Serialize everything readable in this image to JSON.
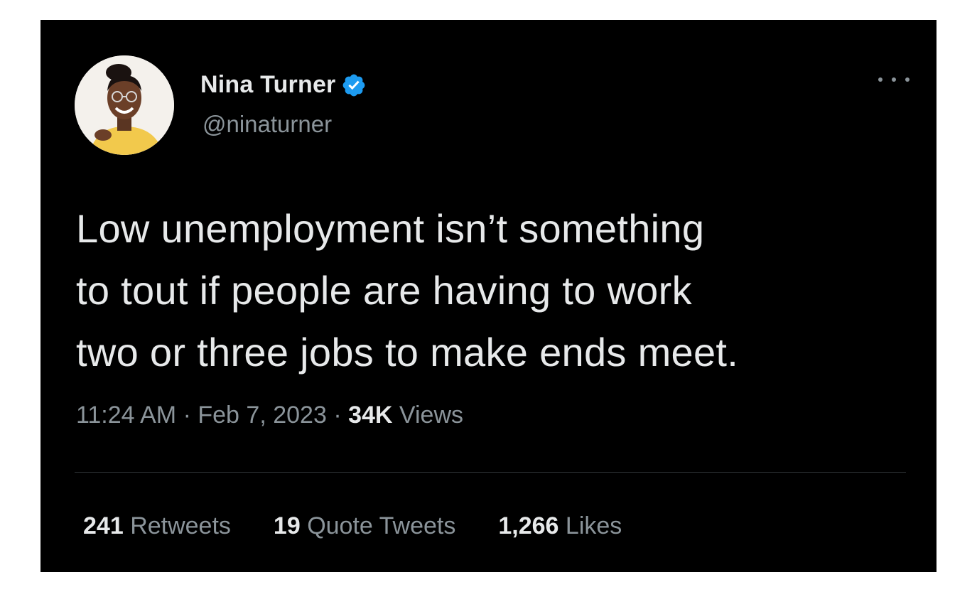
{
  "author": {
    "display_name": "Nina Turner",
    "handle": "@ninaturner",
    "verified_icon": "verified-badge-icon",
    "avatar_icon": "profile-photo"
  },
  "tweet": {
    "text_lines": [
      "Low unemployment isn’t something",
      "to tout if people are having to work",
      "two or three jobs to make ends meet."
    ]
  },
  "meta": {
    "time": "11:24 AM",
    "sep1": "·",
    "date": "Feb 7, 2023",
    "sep2": "·",
    "views_count": "34K",
    "views_label": "Views"
  },
  "stats": {
    "retweets_count": "241",
    "retweets_label": "Retweets",
    "quotes_count": "19",
    "quotes_label": "Quote Tweets",
    "likes_count": "1,266",
    "likes_label": "Likes"
  },
  "colors": {
    "background": "#000000",
    "text": "#e7e9ea",
    "muted": "#8b949a",
    "verified": "#1d9bf0",
    "divider": "#2f3336"
  }
}
